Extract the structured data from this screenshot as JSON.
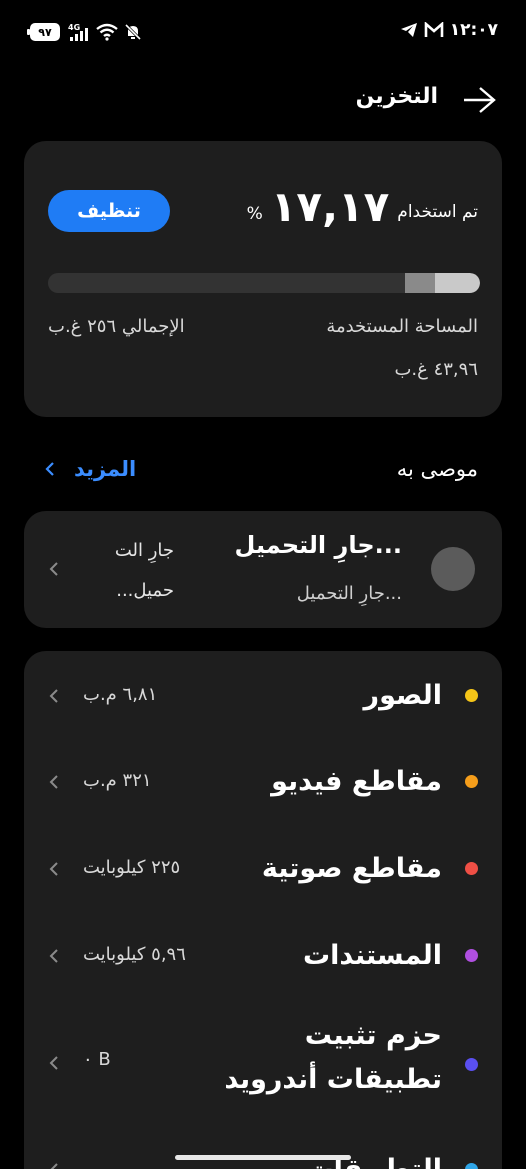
{
  "status_bar": {
    "battery": "٩٧",
    "network": "4G",
    "time": "١٢:٠٧"
  },
  "header": {
    "title": "التخزين"
  },
  "storage": {
    "used_label": "تم استخدام",
    "used_value": "١٧,١٧",
    "used_unit": "%",
    "clean_button": "تنظيف",
    "used_fraction": 0.1717,
    "used_space_label": "المساحة المستخدمة",
    "used_space_value": "٤٣,٩٦ غ.ب",
    "total_label": "الإجمالي ٢٥٦ غ.ب"
  },
  "recommended": {
    "title": "موصى به",
    "more_label": "المزيد",
    "item": {
      "title": "جارِ التحميل...",
      "subtitle": "جارِ التحميل...",
      "side_line1": "جارِ الت",
      "side_line2": "حميل..."
    }
  },
  "categories": [
    {
      "label": "الصور",
      "size": "٦,٨١ م.ب",
      "color": "#f5c518"
    },
    {
      "label": "مقاطع فيديو",
      "size": "٣٢١ م.ب",
      "color": "#f59e1b"
    },
    {
      "label": "مقاطع صوتية",
      "size": "٢٢٥ كيلوبايت",
      "color": "#ef4f45"
    },
    {
      "label": "المستندات",
      "size": "٥,٩٦ كيلوبايت",
      "color": "#b04fe0"
    },
    {
      "label": "حزم تثبيت تطبيقات أندرويد",
      "size": "B ٠",
      "color": "#5a4ff0"
    },
    {
      "label": "التطبيقات",
      "size": "",
      "color": "#2fa6e8"
    }
  ],
  "colors": {
    "accent": "#1f7cf5",
    "link": "#3b8dff",
    "card_bg": "#1e1e1e"
  }
}
